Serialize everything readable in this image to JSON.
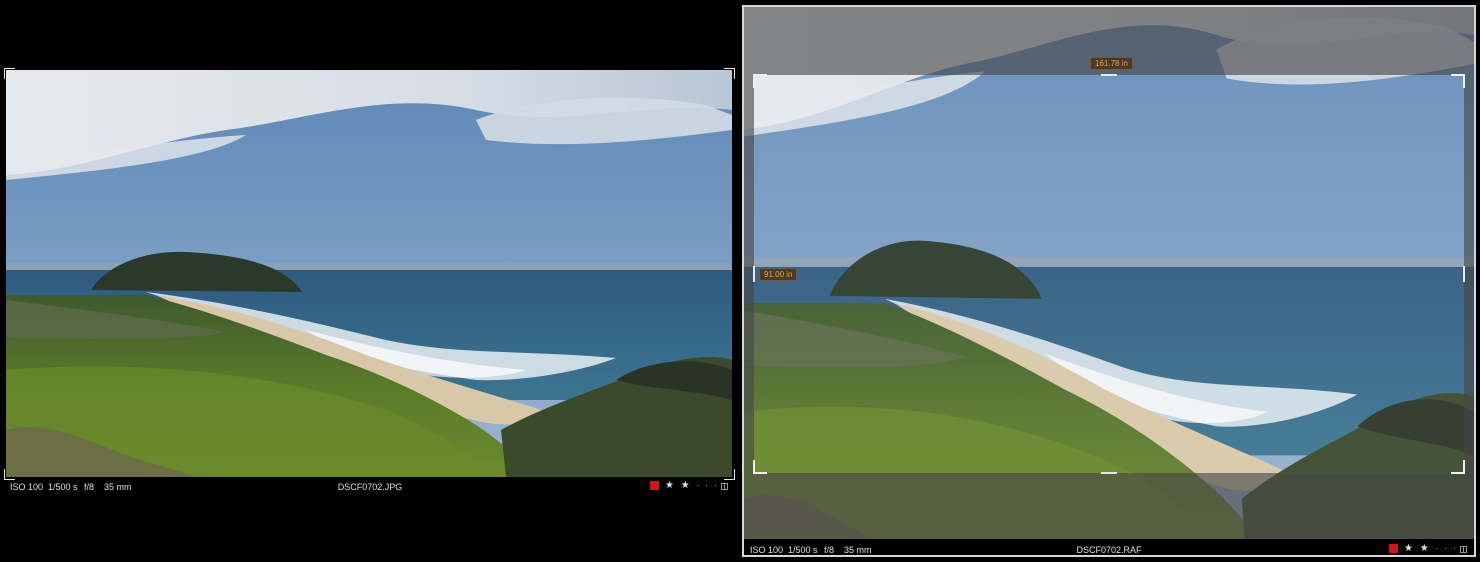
{
  "left_viewer": {
    "meta": {
      "iso": "ISO 100",
      "shutter": "1/500 s",
      "aperture": "f/8",
      "focal": "35 mm"
    },
    "filename": "DSCF0702.JPG",
    "rating": {
      "stars": "★ ★",
      "empty": "· · ·"
    },
    "color_label": "#d0141a"
  },
  "right_viewer": {
    "meta": {
      "iso": "ISO 100",
      "shutter": "1/500 s",
      "aperture": "f/8",
      "focal": "35 mm"
    },
    "filename": "DSCF0702.RAF",
    "rating": {
      "stars": "★ ★",
      "empty": "· · ·"
    },
    "color_label": "#d0141a",
    "crop": {
      "width_label": "161.78 in",
      "height_label": "91.00 in"
    }
  },
  "colors": {
    "measure_text": "#f0a030",
    "label_red": "#d0141a"
  }
}
